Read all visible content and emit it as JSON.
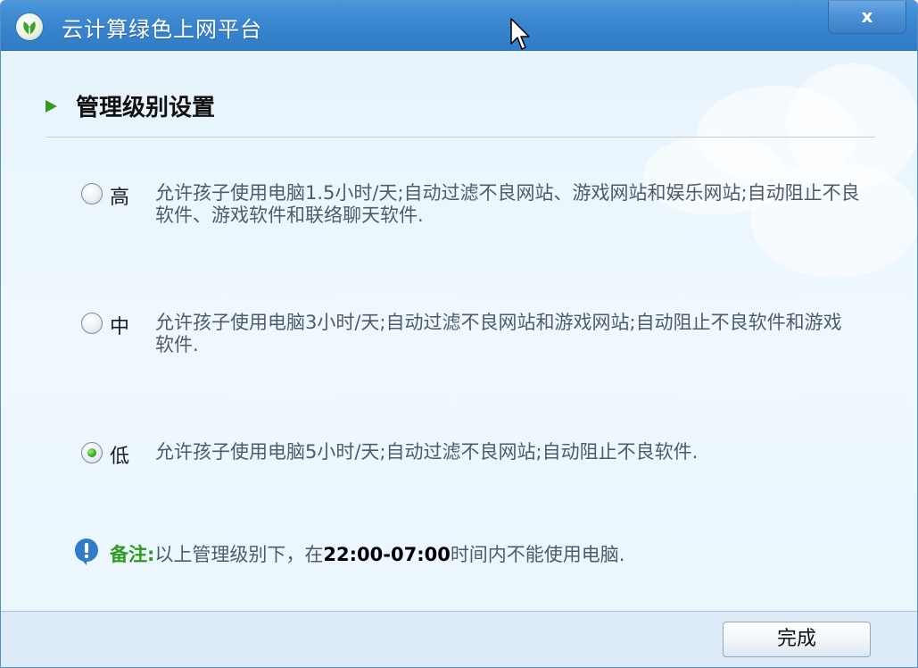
{
  "window": {
    "title": "云计算绿色上网平台",
    "close_label": "x"
  },
  "section": {
    "title": "管理级别设置"
  },
  "options": [
    {
      "label": "高",
      "selected": false,
      "description": "允许孩子使用电脑1.5小时/天;自动过滤不良网站、游戏网站和娱乐网站;自动阻止不良软件、游戏软件和联络聊天软件."
    },
    {
      "label": "中",
      "selected": false,
      "description": "允许孩子使用电脑3小时/天;自动过滤不良网站和游戏网站;自动阻止不良软件和游戏软件."
    },
    {
      "label": "低",
      "selected": true,
      "description": "允许孩子使用电脑5小时/天;自动过滤不良网站;自动阻止不良软件."
    }
  ],
  "note": {
    "label": "备注:",
    "text_before": "以上管理级别下，在",
    "time": "22:00-07:00",
    "text_after": "时间内不能使用电脑."
  },
  "footer": {
    "done_label": "完成"
  },
  "colors": {
    "title_bar": "#3a86cf",
    "accent_green": "#2f9a1e",
    "info_blue": "#2f7cc8"
  },
  "icons": {
    "app": "green-leaf-logo-icon",
    "section": "green-arrow-icon",
    "note": "info-icon",
    "cursor": "mouse-cursor-icon"
  }
}
